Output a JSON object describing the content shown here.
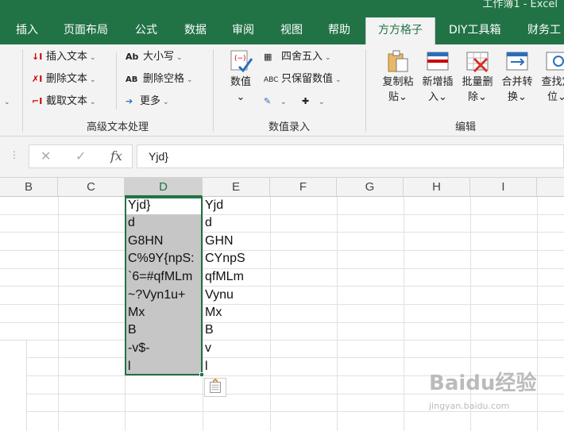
{
  "app": {
    "window_title": "工作簿1 - Excel"
  },
  "tabs": [
    {
      "label": "插入",
      "active": false
    },
    {
      "label": "页面布局",
      "active": false
    },
    {
      "label": "公式",
      "active": false
    },
    {
      "label": "数据",
      "active": false
    },
    {
      "label": "审阅",
      "active": false
    },
    {
      "label": "视图",
      "active": false
    },
    {
      "label": "帮助",
      "active": false
    },
    {
      "label": "方方格子",
      "active": true
    },
    {
      "label": "DIY工具箱",
      "active": false
    },
    {
      "label": "财务工",
      "active": false
    }
  ],
  "ribbon": {
    "text_group": {
      "label": "高级文本处理",
      "insert_text": "插入文本",
      "delete_text": "删除文本",
      "extract_text": "截取文本",
      "case": "大小写",
      "remove_spaces": "删除空格",
      "more": "更多",
      "case_icon": "Ab",
      "spaces_icon": "AB"
    },
    "entry_group": {
      "label": "数值录入",
      "value": "数值",
      "round": "四舍五入",
      "keep_value": "只保留数值",
      "keep_icon": "ABC"
    },
    "edit_group": {
      "label": "编辑",
      "buttons": [
        {
          "line1": "复制粘",
          "line2": "贴"
        },
        {
          "line1": "新增插",
          "line2": "入"
        },
        {
          "line1": "批量删",
          "line2": "除"
        },
        {
          "line1": "合并转",
          "line2": "换"
        },
        {
          "line1": "查找定",
          "line2": "位"
        }
      ]
    }
  },
  "formula_bar": {
    "cancel": "✕",
    "enter": "✓",
    "fx": "fx",
    "value": "Yjd}"
  },
  "columns": [
    {
      "label": "B",
      "selected": false
    },
    {
      "label": "C",
      "selected": false
    },
    {
      "label": "D",
      "selected": true
    },
    {
      "label": "E",
      "selected": false
    },
    {
      "label": "F",
      "selected": false
    },
    {
      "label": "G",
      "selected": false
    },
    {
      "label": "H",
      "selected": false
    },
    {
      "label": "I",
      "selected": false
    }
  ],
  "cells": {
    "D": [
      "Yjd}",
      "d",
      "G8HN",
      "C%9Y{npS:",
      "`6=#qfMLm",
      "~?Vyn1u+",
      "Mx",
      "B",
      "-v$-",
      "l"
    ],
    "E": [
      "Yjd",
      "d",
      "GHN",
      "CYnpS",
      "qfMLm",
      "Vynu",
      "Mx",
      "B",
      "v",
      "l"
    ]
  },
  "watermark": {
    "main": "Baidu经验",
    "sub": "jingyan.baidu.com"
  },
  "colors": {
    "brand": "#217346",
    "selection": "#c6c6c6"
  }
}
